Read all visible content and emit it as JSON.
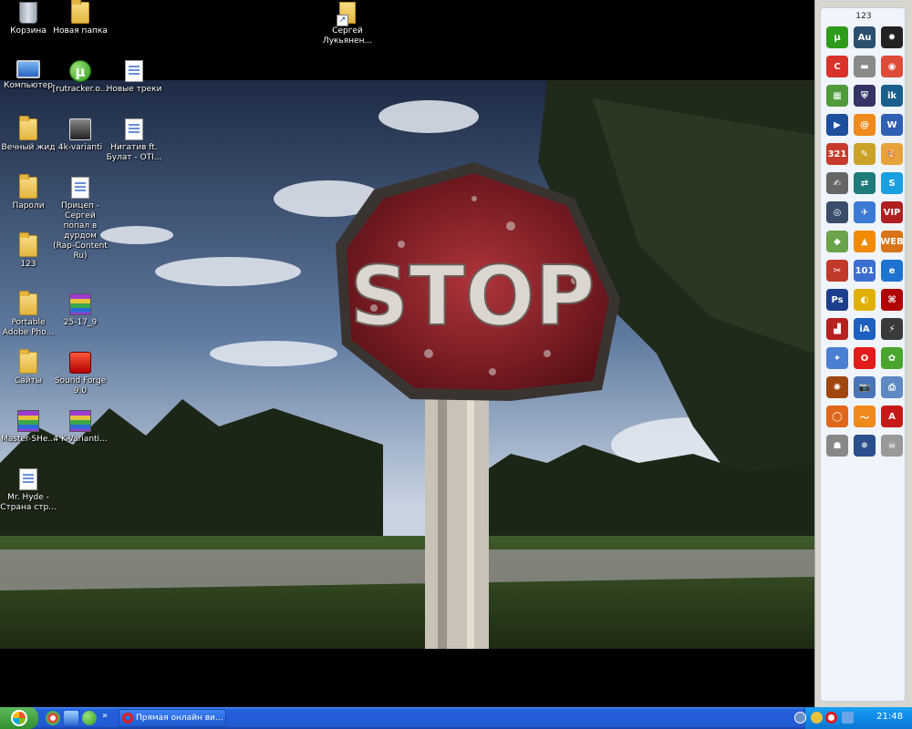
{
  "desktop_icons": [
    {
      "label": "Корзина",
      "icon": "recycle-bin-icon"
    },
    {
      "label": "Новая папка",
      "icon": "folder-icon"
    },
    {
      "label": "Сергей Лукьянен...",
      "icon": "folder-shortcut-icon"
    },
    {
      "label": "Компьютер",
      "icon": "computer-icon"
    },
    {
      "label": "[rutracker.o...",
      "icon": "utorrent-icon"
    },
    {
      "label": "Новые треки",
      "icon": "document-icon"
    },
    {
      "label": "Вечный жид",
      "icon": "folder-icon"
    },
    {
      "label": "4k-varianti",
      "icon": "media-icon"
    },
    {
      "label": "Нигатив ft. Булат - OTI...",
      "icon": "document-icon"
    },
    {
      "label": "Пароли",
      "icon": "folder-icon"
    },
    {
      "label": "Прицеп - Сергей попал в дурдом (Rap-Content Ru)",
      "icon": "document-icon"
    },
    {
      "label": "123",
      "icon": "folder-icon"
    },
    {
      "label": "Portable Adobe Pho...",
      "icon": "folder-icon"
    },
    {
      "label": "25-17_9",
      "icon": "winrar-icon"
    },
    {
      "label": "Сайты",
      "icon": "folder-icon"
    },
    {
      "label": "Sound Forge 9.0",
      "icon": "sound-forge-icon"
    },
    {
      "label": "Master-SHe...",
      "icon": "winrar-icon"
    },
    {
      "label": "4 K-Varianti...",
      "icon": "winrar-icon"
    },
    {
      "label": "Mr. Hyde - Страна стр...",
      "icon": "document-icon"
    }
  ],
  "wallpaper": {
    "sign_text": "STOP"
  },
  "launcher": {
    "title": "123",
    "items": [
      {
        "icon": "utorrent-icon",
        "color": "#2e9b1c",
        "text": "µ"
      },
      {
        "icon": "audition-icon",
        "color": "#2b4f6f",
        "text": "Au"
      },
      {
        "icon": "gear-icon",
        "color": "#222222",
        "text": "✹"
      },
      {
        "icon": "ccleaner-icon",
        "color": "#d8322a",
        "text": "C"
      },
      {
        "icon": "tool-icon",
        "color": "#8a8a8a",
        "text": "▬"
      },
      {
        "icon": "chrome-icon",
        "color": "#dd4b39",
        "text": "◉"
      },
      {
        "icon": "map-icon",
        "color": "#4f9a3a",
        "text": "▦"
      },
      {
        "icon": "shield-icon",
        "color": "#333366",
        "text": "⛨"
      },
      {
        "icon": "ik-icon",
        "color": "#1a5f8c",
        "text": "ik"
      },
      {
        "icon": "player-icon",
        "color": "#1d4f9c",
        "text": "▶"
      },
      {
        "icon": "mail-icon",
        "color": "#f08a1c",
        "text": "@"
      },
      {
        "icon": "word-icon",
        "color": "#2f5fb3",
        "text": "W"
      },
      {
        "icon": "calendar-icon",
        "color": "#c63b2d",
        "text": "321"
      },
      {
        "icon": "notepad-icon",
        "color": "#c9a227",
        "text": "✎"
      },
      {
        "icon": "paint-icon",
        "color": "#e8a23b",
        "text": "🎨"
      },
      {
        "icon": "pen-icon",
        "color": "#666666",
        "text": "✍"
      },
      {
        "icon": "teamviewer-icon",
        "color": "#1f7a7a",
        "text": "⇄"
      },
      {
        "icon": "skype-icon",
        "color": "#1aa0e0",
        "text": "S"
      },
      {
        "icon": "steam-icon",
        "color": "#3a4d6a",
        "text": "◎"
      },
      {
        "icon": "bird-icon",
        "color": "#3b7bd6",
        "text": "✈"
      },
      {
        "icon": "vip-icon",
        "color": "#b01f1f",
        "text": "VIP"
      },
      {
        "icon": "crystal-icon",
        "color": "#6aa34a",
        "text": "◆"
      },
      {
        "icon": "vlc-icon",
        "color": "#f08a00",
        "text": "▲"
      },
      {
        "icon": "web-surf-icon",
        "color": "#d9731a",
        "text": "WEB"
      },
      {
        "icon": "scissors-icon",
        "color": "#c0392b",
        "text": "✂"
      },
      {
        "icon": "ruler-icon",
        "color": "#3b6fd1",
        "text": "101"
      },
      {
        "icon": "ie-icon",
        "color": "#1e73d0",
        "text": "e"
      },
      {
        "icon": "photoshop-icon",
        "color": "#1b3f8c",
        "text": "Ps"
      },
      {
        "icon": "cd-icon",
        "color": "#e0b000",
        "text": "◐"
      },
      {
        "icon": "daemon-icon",
        "color": "#b00000",
        "text": "⌘"
      },
      {
        "icon": "chart-icon",
        "color": "#b82020",
        "text": "▟"
      },
      {
        "icon": "ia-icon",
        "color": "#1e5fc2",
        "text": "iA"
      },
      {
        "icon": "winamp-icon",
        "color": "#3a3a3a",
        "text": "⚡"
      },
      {
        "icon": "joystick-icon",
        "color": "#4a7fd1",
        "text": "✦"
      },
      {
        "icon": "opera-icon",
        "color": "#e21b1b",
        "text": "O"
      },
      {
        "icon": "icq-icon",
        "color": "#4aa52e",
        "text": "✿"
      },
      {
        "icon": "basketball-icon",
        "color": "#a0460f",
        "text": "✺"
      },
      {
        "icon": "camera-icon",
        "color": "#4a74b8",
        "text": "📷"
      },
      {
        "icon": "printer-icon",
        "color": "#5e89c2",
        "text": "⎙"
      },
      {
        "icon": "firefox-icon",
        "color": "#e0661b",
        "text": "◯"
      },
      {
        "icon": "swoosh-icon",
        "color": "#f08a1c",
        "text": "〜"
      },
      {
        "icon": "acrobat-icon",
        "color": "#c61a1a",
        "text": "A"
      },
      {
        "icon": "stormtrooper-icon",
        "color": "#888888",
        "text": "☗"
      },
      {
        "icon": "starcraft-icon",
        "color": "#2a4f8c",
        "text": "✵"
      },
      {
        "icon": "skull-icon",
        "color": "#999999",
        "text": "☠"
      }
    ]
  },
  "taskbar": {
    "task_label": "Прямая онлайн ви...",
    "clock": "21:48",
    "chevron": "»"
  }
}
